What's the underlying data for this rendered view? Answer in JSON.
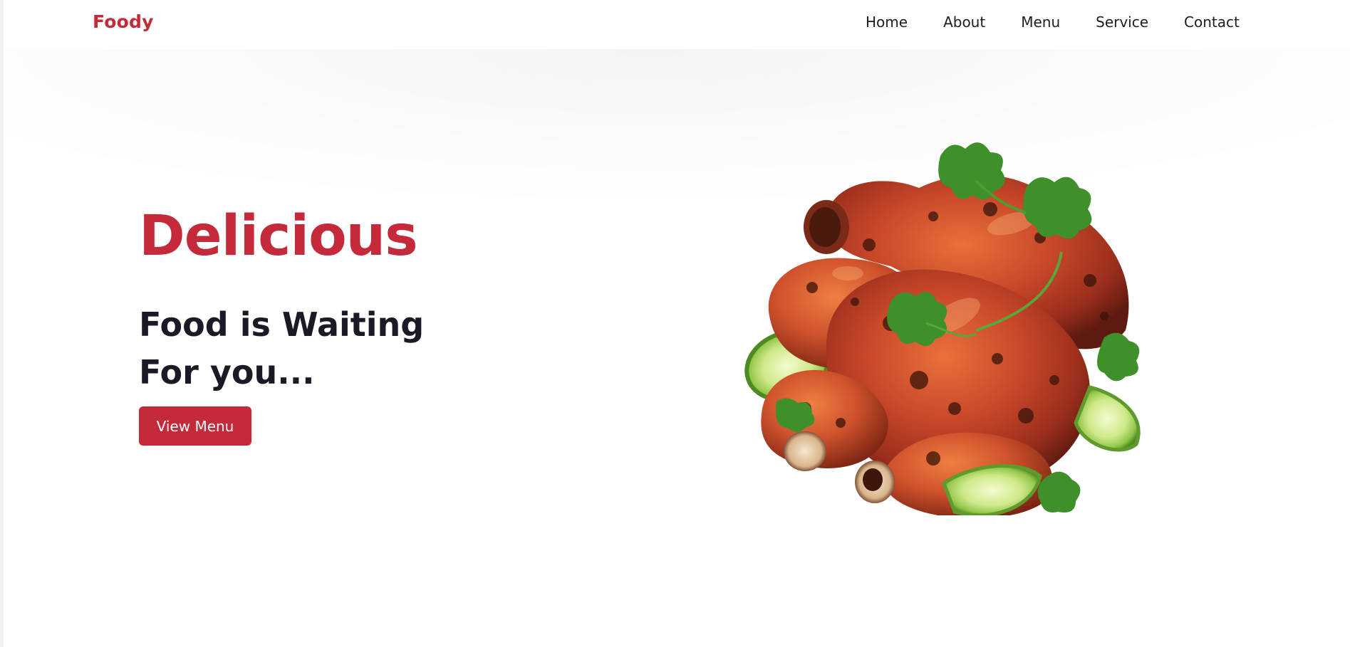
{
  "brand": {
    "name": "Foody",
    "color": "#c42a3a"
  },
  "nav": {
    "items": [
      {
        "label": "Home"
      },
      {
        "label": "About"
      },
      {
        "label": "Menu"
      },
      {
        "label": "Service"
      },
      {
        "label": "Contact"
      }
    ]
  },
  "hero": {
    "title": "Delicious",
    "subtitle_line1": "Food is Waiting",
    "subtitle_line2": "For you...",
    "cta_label": "View Menu",
    "image_subject": "roasted-chicken-legs-with-cilantro-and-lime"
  },
  "colors": {
    "accent": "#c42a3a",
    "text_dark": "#1a1a26",
    "background": "#ffffff"
  }
}
